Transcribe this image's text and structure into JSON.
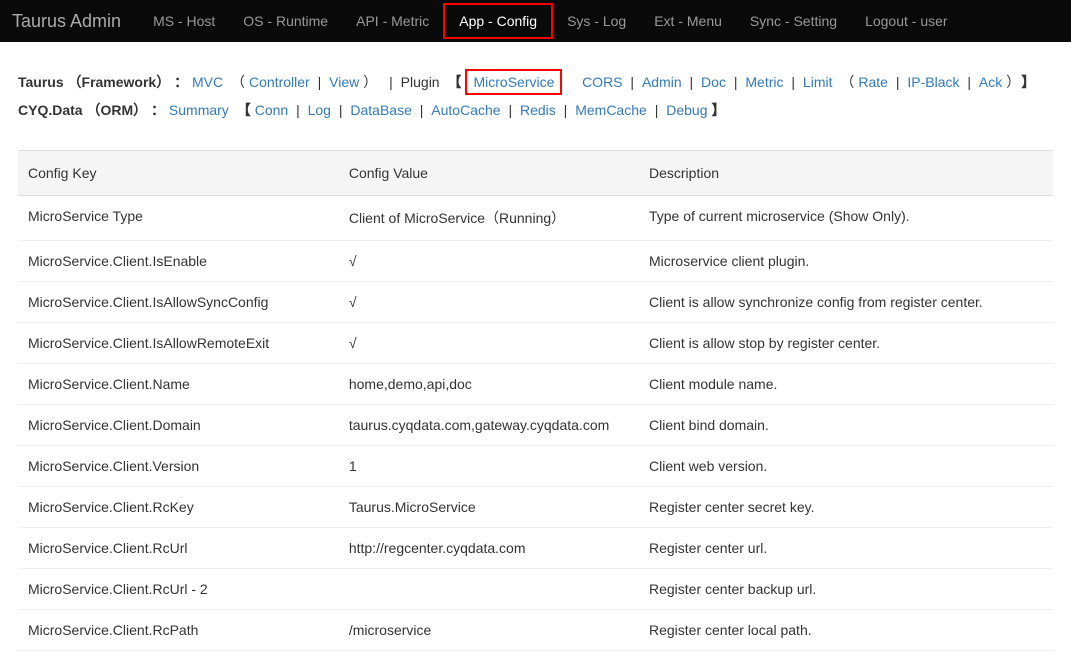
{
  "navbar": {
    "brand": "Taurus Admin",
    "items": [
      "MS - Host",
      "OS - Runtime",
      "API - Metric",
      "App - Config",
      "Sys - Log",
      "Ext - Menu",
      "Sync - Setting",
      "Logout - user"
    ],
    "active_index": 3
  },
  "breadcrumb1": {
    "prefix": "Taurus （Framework） ：",
    "segs": {
      "mvc": "MVC",
      "controller": "Controller",
      "view": "View",
      "plugin": "Plugin",
      "microservice": "MicroService",
      "cors": "CORS",
      "admin": "Admin",
      "doc": "Doc",
      "metric": "Metric",
      "limit": "Limit",
      "rate": "Rate",
      "ipblack": "IP-Black",
      "ack": "Ack"
    }
  },
  "breadcrumb2": {
    "prefix": "CYQ.Data （ORM） ：",
    "segs": {
      "summary": "Summary",
      "conn": "Conn",
      "log": "Log",
      "database": "DataBase",
      "autocache": "AutoCache",
      "redis": "Redis",
      "memcache": "MemCache",
      "debug": "Debug"
    }
  },
  "table": {
    "headers": {
      "key": "Config Key",
      "value": "Config Value",
      "desc": "Description"
    },
    "rows": [
      {
        "key": "MicroService Type",
        "value": "Client of MicroService（Running）",
        "desc": "Type of current microservice (Show Only)."
      },
      {
        "key": "MicroService.Client.IsEnable",
        "value": "√",
        "desc": "Microservice client plugin."
      },
      {
        "key": "MicroService.Client.IsAllowSyncConfig",
        "value": "√",
        "desc": "Client is allow synchronize config from register center."
      },
      {
        "key": "MicroService.Client.IsAllowRemoteExit",
        "value": "√",
        "desc": "Client is allow stop by register center."
      },
      {
        "key": "MicroService.Client.Name",
        "value": "home,demo,api,doc",
        "desc": "Client module name."
      },
      {
        "key": "MicroService.Client.Domain",
        "value": "taurus.cyqdata.com,gateway.cyqdata.com",
        "desc": "Client bind domain."
      },
      {
        "key": "MicroService.Client.Version",
        "value": "1",
        "desc": "Client web version."
      },
      {
        "key": "MicroService.Client.RcKey",
        "value": "Taurus.MicroService",
        "desc": "Register center secret key."
      },
      {
        "key": "MicroService.Client.RcUrl",
        "value": "http://regcenter.cyqdata.com",
        "desc": "Register center url."
      },
      {
        "key": "MicroService.Client.RcUrl - 2",
        "value": "",
        "desc": "Register center backup url."
      },
      {
        "key": "MicroService.Client.RcPath",
        "value": "/microservice",
        "desc": "Register center local path."
      }
    ]
  }
}
